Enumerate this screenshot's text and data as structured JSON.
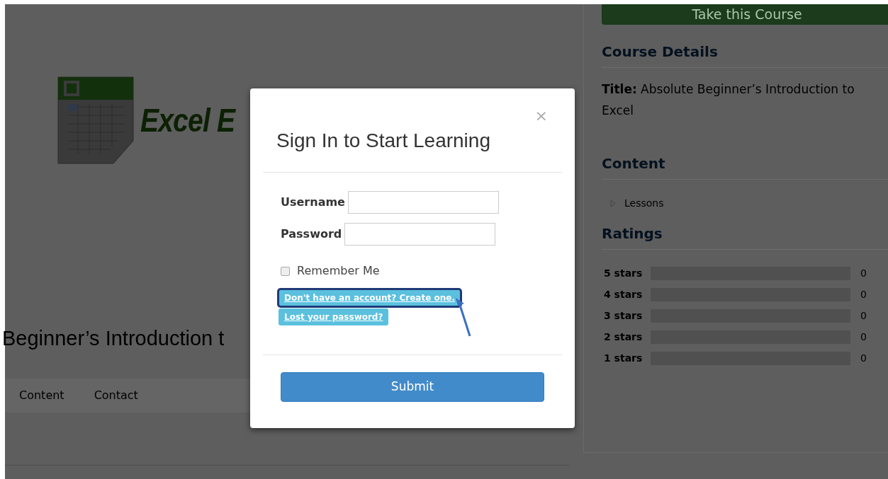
{
  "logo": {
    "text": "Excel E"
  },
  "course_heading": "Beginner’s Introduction t",
  "nav": [
    {
      "label": "Content"
    },
    {
      "label": "Contact"
    }
  ],
  "sidebar": {
    "cta": "Take this Course",
    "details_heading": "Course Details",
    "title_text": "**Title:** Absolute Beginner’s Introduction to Excel",
    "content_heading": "Content",
    "lessons": {
      "label": "Lessons",
      "expanded": false
    },
    "ratings_heading": "Ratings",
    "ratings": [
      {
        "label": "5 stars",
        "count": "0"
      },
      {
        "label": "4 stars",
        "count": "0"
      },
      {
        "label": "3 stars",
        "count": "0"
      },
      {
        "label": "2 stars",
        "count": "0"
      },
      {
        "label": "1 stars",
        "count": "0"
      }
    ]
  },
  "modal": {
    "title": "Sign In to Start Learning",
    "close": "×",
    "fields": [
      {
        "label": "Username"
      },
      {
        "label": "Password"
      }
    ],
    "remember": {
      "label": "Remember Me",
      "checked": false
    },
    "links": [
      {
        "label": "Don't have an account? Create one.",
        "highlighted": true
      },
      {
        "label": "Lost your password?",
        "highlighted": false
      }
    ],
    "submit": "Submit"
  }
}
